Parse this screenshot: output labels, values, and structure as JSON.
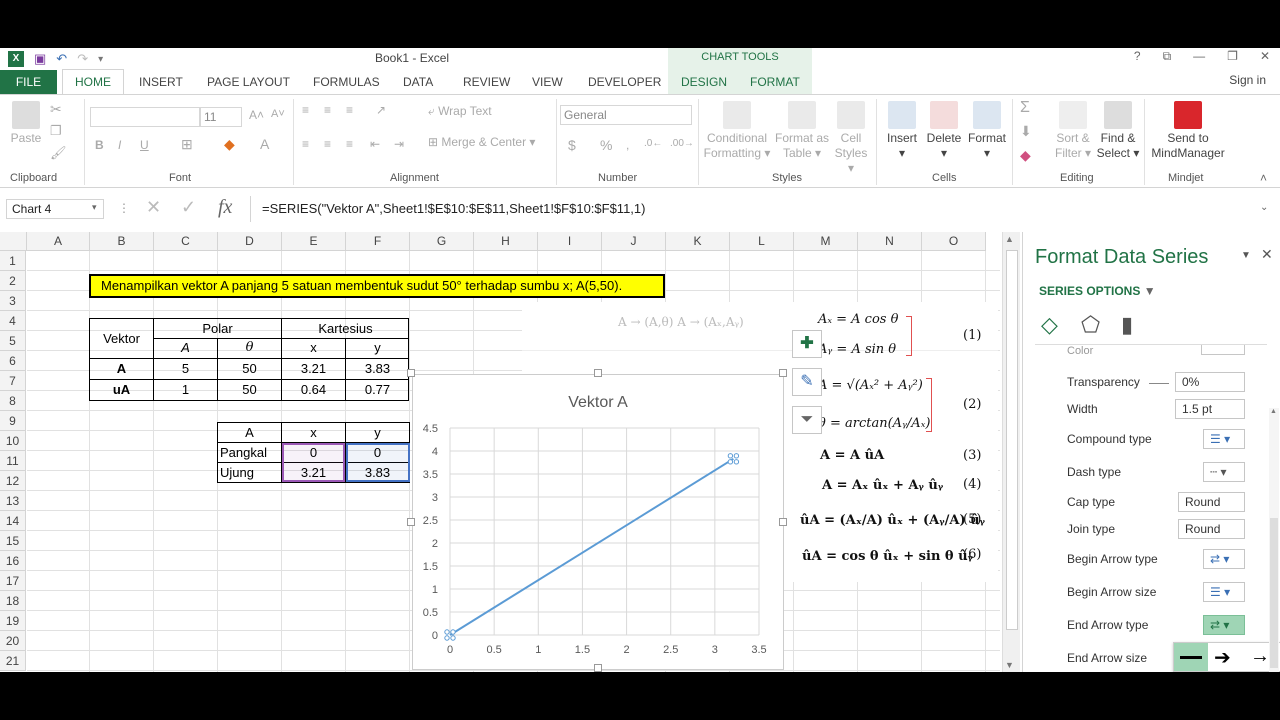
{
  "window": {
    "title": "Book1 - Excel",
    "chart_tools": "CHART TOOLS",
    "signin": "Sign in",
    "help": "?"
  },
  "tabs": [
    "FILE",
    "HOME",
    "INSERT",
    "PAGE LAYOUT",
    "FORMULAS",
    "DATA",
    "REVIEW",
    "VIEW",
    "DEVELOPER",
    "DESIGN",
    "FORMAT"
  ],
  "ribbon": {
    "clipboard": {
      "paste": "Paste",
      "label": "Clipboard"
    },
    "font": {
      "size": "11",
      "label": "Font",
      "bold": "B",
      "italic": "I",
      "underline": "U"
    },
    "alignment": {
      "wrap": "Wrap Text",
      "merge": "Merge & Center",
      "label": "Alignment"
    },
    "number": {
      "format": "General",
      "label": "Number",
      "currency": "$",
      "percent": "%"
    },
    "styles": {
      "cond": "Conditional",
      "cond2": "Formatting",
      "fmt_table": "Format as",
      "fmt_table2": "Table",
      "cell_styles": "Cell",
      "cell_styles2": "Styles",
      "label": "Styles"
    },
    "cells": {
      "insert": "Insert",
      "delete": "Delete",
      "format": "Format",
      "label": "Cells"
    },
    "editing": {
      "sort": "Sort &",
      "sort2": "Filter",
      "find": "Find &",
      "find2": "Select",
      "label": "Editing"
    },
    "mindjet": {
      "send": "Send to",
      "send2": "MindManager",
      "label": "Mindjet"
    }
  },
  "formula_bar": {
    "name_box": "Chart 4",
    "fx": "fx",
    "formula": "=SERIES(\"Vektor A\",Sheet1!$E$10:$E$11,Sheet1!$F$10:$F$11,1)"
  },
  "columns": [
    "A",
    "B",
    "C",
    "D",
    "E",
    "F",
    "G",
    "H",
    "I",
    "J",
    "K",
    "L",
    "M",
    "N",
    "O"
  ],
  "rows": [
    "1",
    "2",
    "3",
    "4",
    "5",
    "6",
    "7",
    "8",
    "9",
    "10",
    "11",
    "12",
    "13",
    "14",
    "15",
    "16",
    "17",
    "18",
    "19",
    "20",
    "21"
  ],
  "sheet": {
    "banner": "Menampilkan vektor A panjang 5 satuan membentuk sudut 50° terhadap sumbu x; A(5,50).",
    "table1": {
      "vektor": "Vektor",
      "polar": "Polar",
      "kartesius": "Kartesius",
      "sub": [
        "A",
        "θ",
        "x",
        "y"
      ],
      "rows": [
        {
          "name": "A",
          "vals": [
            "5",
            "50",
            "3.21",
            "3.83"
          ]
        },
        {
          "name": "uA",
          "vals": [
            "1",
            "50",
            "0.64",
            "0.77"
          ]
        }
      ]
    },
    "table2": {
      "header": [
        "A",
        "x",
        "y"
      ],
      "rows": [
        [
          "Pangkal",
          "0",
          "0"
        ],
        [
          "Ujung",
          "3.21",
          "3.83"
        ]
      ]
    }
  },
  "chart_data": {
    "type": "line",
    "title": "Vektor A",
    "xlim": [
      0,
      3.5
    ],
    "ylim": [
      0,
      4.5
    ],
    "xticks": [
      "0",
      "0.5",
      "1",
      "1.5",
      "2",
      "2.5",
      "3",
      "3.5"
    ],
    "yticks": [
      "0",
      "0.5",
      "1",
      "1.5",
      "2",
      "2.5",
      "3",
      "3.5",
      "4",
      "4.5"
    ],
    "grid": true,
    "series": [
      {
        "name": "Vektor A",
        "x": [
          0,
          3.21
        ],
        "y": [
          0,
          3.83
        ],
        "color": "#5b9bd5"
      }
    ]
  },
  "equations": {
    "e1a": "Aₓ = A cos θ",
    "e1b": "Aᵧ = A sin θ",
    "n1": "(1)",
    "e2a": "A = √(Aₓ² + Aᵧ²)",
    "e2b": "θ = arctan(Aᵧ/Aₓ)",
    "n2": "(2)",
    "e3": "A = A ûA",
    "n3": "(3)",
    "e4": "A = Aₓ ûₓ + Aᵧ ûᵧ",
    "n4": "(4)",
    "e5": "ûA = (Aₓ/A) ûₓ + (Aᵧ/A) ûᵧ",
    "n5": "(5)",
    "e6": "ûA = cos θ ûₓ + sin θ ûᵧ",
    "n6": "(6)",
    "faded": "A → (A,θ)   A → (Aₓ,Aᵧ)"
  },
  "panel": {
    "title": "Format Data Series",
    "section": "SERIES OPTIONS",
    "color_label": "Color",
    "transparency": {
      "label": "Transparency",
      "value": "0%"
    },
    "width": {
      "label": "Width",
      "value": "1.5 pt"
    },
    "compound": "Compound type",
    "dash": "Dash type",
    "cap": {
      "label": "Cap type",
      "value": "Round"
    },
    "join": {
      "label": "Join type",
      "value": "Round"
    },
    "begin_arrow_type": "Begin Arrow type",
    "begin_arrow_size": "Begin Arrow size",
    "end_arrow_type": "End Arrow type",
    "end_arrow_size": "End Arrow size"
  },
  "accent": "#217346"
}
